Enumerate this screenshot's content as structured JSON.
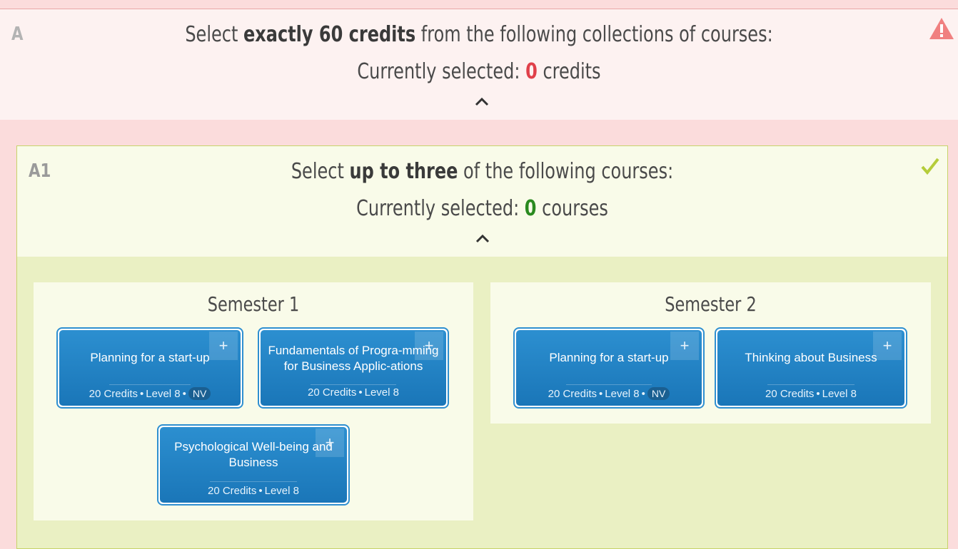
{
  "groupA": {
    "label": "A",
    "instruction_pre": "Select",
    "instruction_bold": "exactly 60 credits",
    "instruction_post": "from the following collections of courses:",
    "selected_pre": "Currently selected:",
    "selected_count": "0",
    "selected_post": "credits",
    "status_icon": "warning-icon",
    "status_color": "#e0404a"
  },
  "groupA1": {
    "label": "A1",
    "instruction_pre": "Select",
    "instruction_bold": "up to three",
    "instruction_post": "of the following courses:",
    "selected_pre": "Currently selected:",
    "selected_count": "0",
    "selected_post": "courses",
    "status_icon": "check-icon",
    "status_color": "#b5cc3a"
  },
  "semesters": [
    {
      "title": "Semester 1",
      "courses": [
        {
          "title": "Planning for a start-up",
          "credits": "20 Credits",
          "level": "Level 8",
          "badge": "NV",
          "add": "+"
        },
        {
          "title": "Fundamentals of Progra-mming for Business Applic-ations",
          "credits": "20 Credits",
          "level": "Level 8",
          "badge": "",
          "add": "+"
        },
        {
          "title": "Psychological Well-being and Business",
          "credits": "20 Credits",
          "level": "Level 8",
          "badge": "",
          "add": "+"
        }
      ]
    },
    {
      "title": "Semester 2",
      "courses": [
        {
          "title": "Planning for a start-up",
          "credits": "20 Credits",
          "level": "Level 8",
          "badge": "NV",
          "add": "+"
        },
        {
          "title": "Thinking about Business",
          "credits": "20 Credits",
          "level": "Level 8",
          "badge": "",
          "add": "+"
        }
      ]
    }
  ],
  "separator": "•"
}
